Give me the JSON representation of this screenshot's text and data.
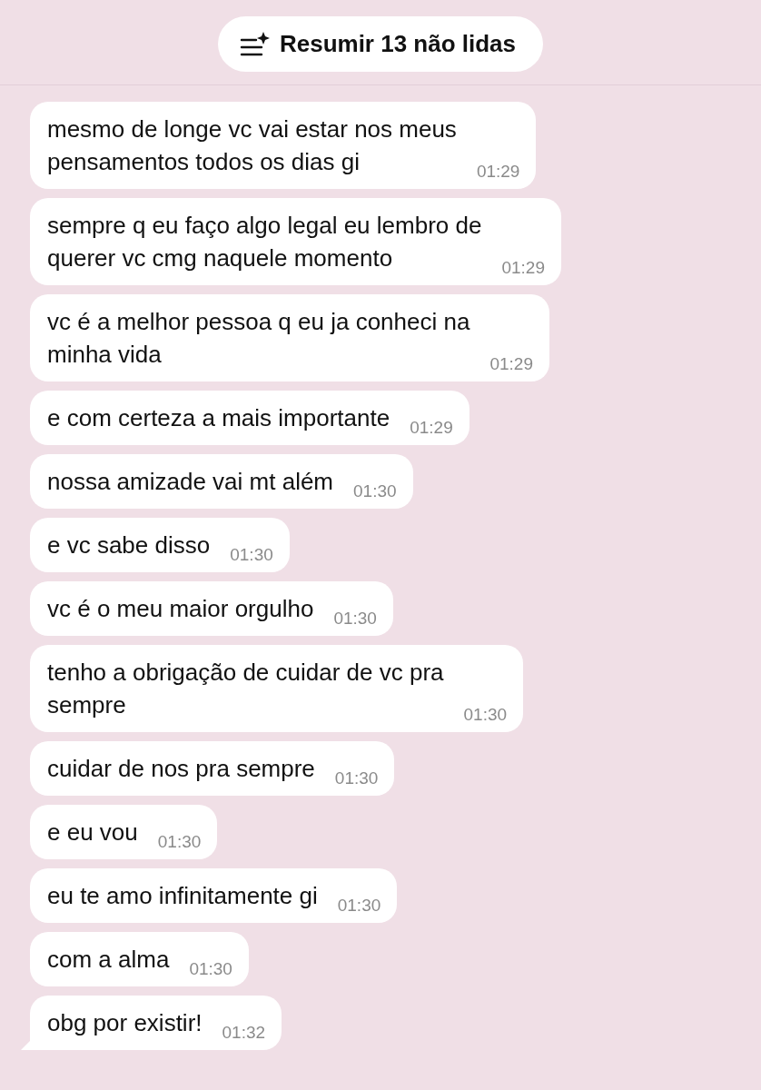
{
  "summary_button": {
    "label": "Resumir 13 não lidas"
  },
  "messages": [
    {
      "lines": [
        "mesmo de longe vc vai estar nos meus",
        "pensamentos todos os dias gi"
      ],
      "time": "01:29",
      "tail": false
    },
    {
      "lines": [
        "sempre q eu faço algo legal eu lembro de",
        "querer vc cmg naquele momento"
      ],
      "time": "01:29",
      "tail": false
    },
    {
      "lines": [
        "vc é a melhor pessoa q eu ja conheci na",
        "minha vida"
      ],
      "time": "01:29",
      "tail": false
    },
    {
      "lines": [
        "e com certeza a mais importante"
      ],
      "time": "01:29",
      "tail": false
    },
    {
      "lines": [
        "nossa amizade vai mt além"
      ],
      "time": "01:30",
      "tail": false
    },
    {
      "lines": [
        "e vc sabe disso"
      ],
      "time": "01:30",
      "tail": false
    },
    {
      "lines": [
        "vc é o meu maior orgulho"
      ],
      "time": "01:30",
      "tail": false
    },
    {
      "lines": [
        "tenho a obrigação de cuidar de vc pra",
        "sempre"
      ],
      "time": "01:30",
      "tail": false
    },
    {
      "lines": [
        "cuidar de nos pra sempre"
      ],
      "time": "01:30",
      "tail": false
    },
    {
      "lines": [
        "e eu vou"
      ],
      "time": "01:30",
      "tail": false
    },
    {
      "lines": [
        "eu te amo infinitamente gi"
      ],
      "time": "01:30",
      "tail": false
    },
    {
      "lines": [
        "com a alma"
      ],
      "time": "01:30",
      "tail": false
    },
    {
      "lines": [
        "obg por existir!"
      ],
      "time": "01:32",
      "tail": true
    }
  ]
}
